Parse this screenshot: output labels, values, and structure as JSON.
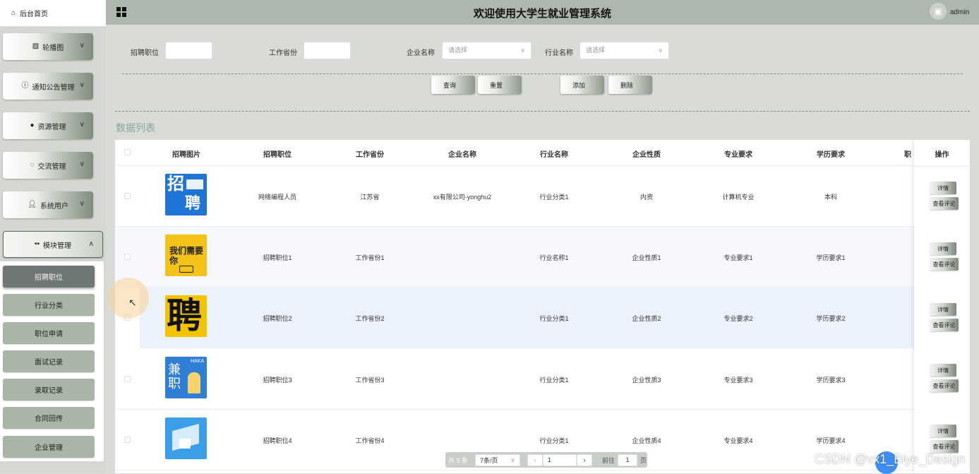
{
  "topbar": {
    "title": "欢迎使用大学生就业管理系统",
    "user": "admin"
  },
  "sidebar": {
    "home": "后台首页",
    "menus": [
      {
        "label": "轮播图",
        "icon": "image-icon"
      },
      {
        "label": "通知公告管理",
        "icon": "info-circle-icon"
      },
      {
        "label": "资源管理",
        "icon": "location-pin-icon"
      },
      {
        "label": "交流管理",
        "icon": "chat-bubble-icon"
      },
      {
        "label": "系统用户",
        "icon": "user-icon"
      },
      {
        "label": "模块管理",
        "icon": "grid-icon"
      }
    ],
    "submenu": [
      "招聘职位",
      "行业分类",
      "职位申请",
      "面试记录",
      "录取记录",
      "合同回传",
      "企业管理"
    ]
  },
  "filters": {
    "position_label": "招聘职位",
    "province_label": "工作省份",
    "company_label": "企业名称",
    "company_placeholder": "请选择",
    "industry_label": "行业名称",
    "industry_placeholder": "请选择"
  },
  "actions": {
    "query": "查询",
    "reset": "重置",
    "add": "添加",
    "delete": "删除"
  },
  "list_title": "数据列表",
  "table": {
    "headers": [
      "招聘图片",
      "招聘职位",
      "工作省份",
      "企业名称",
      "行业名称",
      "企业性质",
      "专业要求",
      "学历要求",
      "职",
      "操作"
    ],
    "rows": [
      {
        "position": "网络编程人员",
        "province": "江苏省",
        "company": "xx有限公司-yonghu2",
        "industry": "行业分类1",
        "nature": "内资",
        "major": "计算机专业",
        "education": "本科",
        "thumb_color": "#1f74d6"
      },
      {
        "position": "招聘职位1",
        "province": "工作省份1",
        "company": "",
        "industry": "行业名称1",
        "nature": "企业性质1",
        "major": "专业要求1",
        "education": "学历要求1",
        "thumb_color": "#f5c21a"
      },
      {
        "position": "招聘职位2",
        "province": "工作省份2",
        "company": "",
        "industry": "行业分类1",
        "nature": "企业性质2",
        "major": "专业要求2",
        "education": "学历要求2",
        "thumb_color": "#f2c300"
      },
      {
        "position": "招聘职位3",
        "province": "工作省份3",
        "company": "",
        "industry": "行业分类1",
        "nature": "企业性质3",
        "major": "专业要求3",
        "education": "学历要求3",
        "thumb_color": "#2f7fd6"
      },
      {
        "position": "招聘职位4",
        "province": "工作省份4",
        "company": "",
        "industry": "行业分类1",
        "nature": "企业性质4",
        "major": "专业要求4",
        "education": "学历要求4",
        "thumb_color": "#3a9ee8"
      }
    ],
    "op_detail": "详情",
    "op_review": "查看评论"
  },
  "thumbs": {
    "t0_big": "招",
    "t0_big2": "聘",
    "t1_text": "我们需要你",
    "t2_big": "聘",
    "t3_brand": "HAKA",
    "t3_big": "兼职"
  },
  "pager": {
    "total": "共 9 条",
    "page_size": "7条/页",
    "current": "1",
    "goto_label": "前往",
    "goto_value": "1",
    "page_unit": "页"
  },
  "watermark": "CSDN @vx1_Biye_Design"
}
